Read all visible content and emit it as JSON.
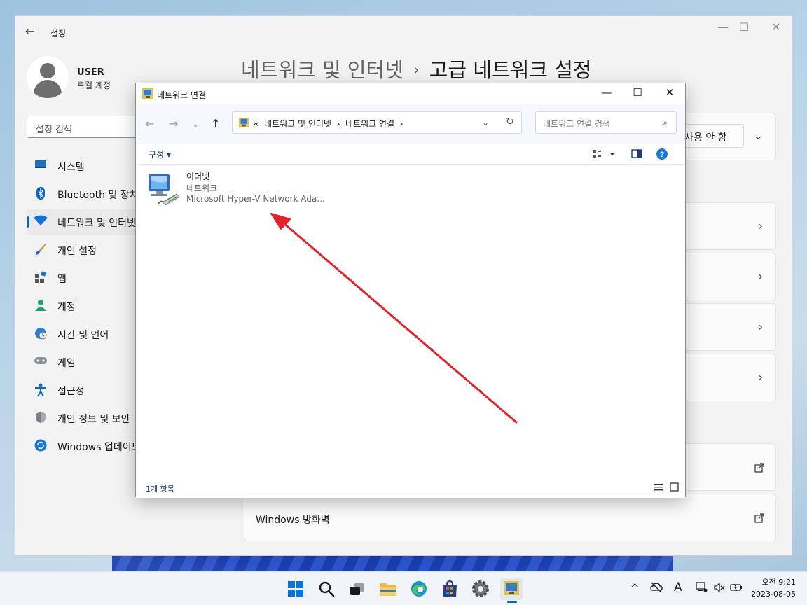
{
  "settings": {
    "app_title": "설정",
    "user": {
      "name": "USER",
      "subtitle": "로컬 계정"
    },
    "search_placeholder": "설정 검색",
    "nav_items": [
      {
        "label": "시스템",
        "icon": "system-icon"
      },
      {
        "label": "Bluetooth 및 장치",
        "icon": "bluetooth-icon"
      },
      {
        "label": "네트워크 및 인터넷",
        "icon": "wifi-icon",
        "active": true
      },
      {
        "label": "개인 설정",
        "icon": "brush-icon"
      },
      {
        "label": "앱",
        "icon": "apps-icon"
      },
      {
        "label": "계정",
        "icon": "account-icon"
      },
      {
        "label": "시간 및 언어",
        "icon": "globe-clock-icon"
      },
      {
        "label": "게임",
        "icon": "gamepad-icon"
      },
      {
        "label": "접근성",
        "icon": "accessibility-icon"
      },
      {
        "label": "개인 정보 및 보안",
        "icon": "shield-icon"
      },
      {
        "label": "Windows 업데이트",
        "icon": "update-icon"
      }
    ],
    "heading": {
      "parent": "네트워크 및 인터넷",
      "separator": "›",
      "current": "고급 네트워크 설정"
    },
    "toggle_button_label": "사용 안 함",
    "firewall_label": "Windows 방화벽"
  },
  "explorer": {
    "title": "네트워크 연결",
    "address": {
      "prefix": "«",
      "crumbs": [
        "네트워크 및 인터넷",
        "네트워크 연결"
      ],
      "sep": "›"
    },
    "search_placeholder": "네트워크 연결 검색",
    "organize_label": "구성 ▾",
    "item": {
      "name": "이더넷",
      "type": "네트워크",
      "device": "Microsoft Hyper-V Network Ada..."
    },
    "status_text": "1개 항목"
  },
  "taskbar": {
    "apps": [
      "start-icon",
      "search-icon",
      "task-view-icon",
      "file-explorer-icon",
      "edge-icon",
      "store-icon",
      "settings-icon",
      "network-connections-icon"
    ],
    "clock": {
      "time": "오전 9:21",
      "date": "2023-08-05"
    },
    "tray_ime": "A"
  },
  "colors": {
    "accent": "#0067c0",
    "arrow": "#e0232c"
  }
}
